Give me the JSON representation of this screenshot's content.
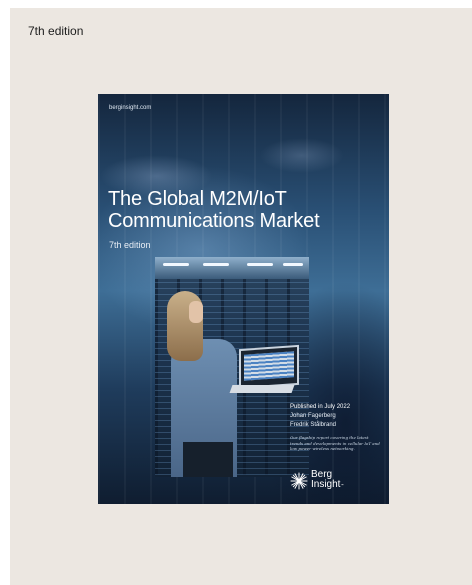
{
  "edition_label": "7th edition",
  "cover": {
    "site": "berginsight.com",
    "title": "The Global M2M/IoT Communications Market",
    "subtitle": "7th edition",
    "published": "Published in July 2022",
    "authors": [
      "Johan Fagerberg",
      "Fredrik Stålbrand"
    ],
    "blurb": "Our flagship report covering the latest trends and developments in cellular IoT and low power wireless networking.",
    "logo_text_line1": "Berg",
    "logo_text_line2": "Insight",
    "logo_tm": "™"
  },
  "colors": {
    "page_background": "#ece7e1",
    "cover_blue": "#294f74"
  }
}
